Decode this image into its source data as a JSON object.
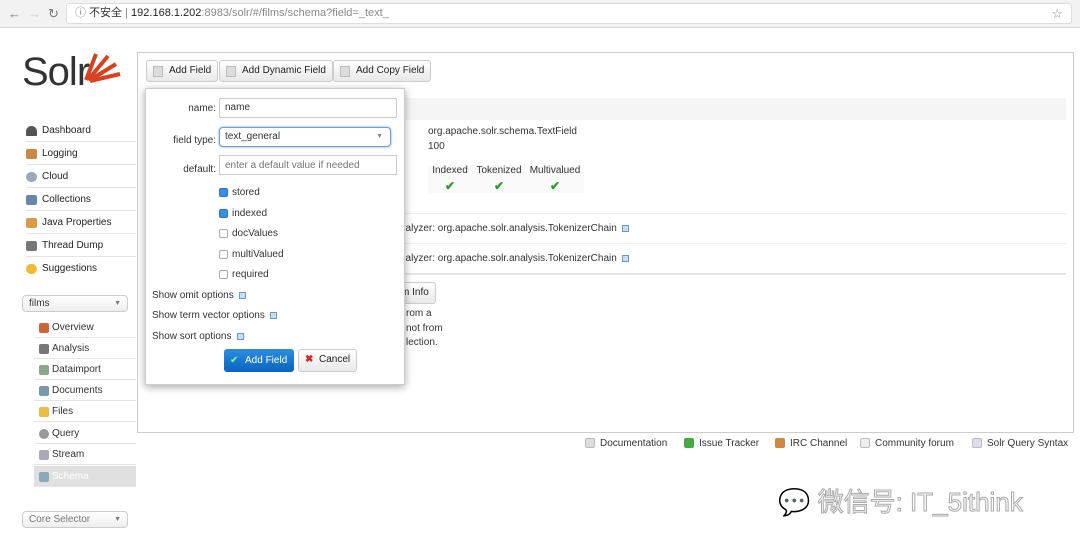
{
  "browser": {
    "insecure_label": "不安全",
    "url_host": "192.168.1.202",
    "url_rest": ":8983/solr/#/films/schema?field=_text_"
  },
  "logo": "Solr",
  "sidebar": {
    "items": [
      {
        "label": "Dashboard",
        "color": "#555"
      },
      {
        "label": "Logging",
        "color": "#c84"
      },
      {
        "label": "Cloud",
        "color": "#9ab"
      },
      {
        "label": "Collections",
        "color": "#68a"
      },
      {
        "label": "Java Properties",
        "color": "#d94"
      },
      {
        "label": "Thread Dump",
        "color": "#777"
      },
      {
        "label": "Suggestions",
        "color": "#eb3"
      }
    ],
    "core_select": "films",
    "core_items": [
      {
        "label": "Overview",
        "color": "#c63"
      },
      {
        "label": "Analysis",
        "color": "#777"
      },
      {
        "label": "Dataimport",
        "color": "#8a8"
      },
      {
        "label": "Documents",
        "color": "#79a"
      },
      {
        "label": "Files",
        "color": "#eb4"
      },
      {
        "label": "Query",
        "color": "#999"
      },
      {
        "label": "Stream",
        "color": "#aab"
      },
      {
        "label": "Schema",
        "color": "#8ab",
        "selected": true
      }
    ],
    "core_selector": "Core Selector"
  },
  "toolbar": {
    "add_field": "Add Field",
    "add_dynamic_field": "Add Dynamic Field",
    "add_copy_field": "Add Copy Field"
  },
  "popup": {
    "name_label": "name:",
    "name_value": "name",
    "field_type_label": "field type:",
    "field_type_value": "text_general",
    "default_label": "default:",
    "default_placeholder": "enter a default value if needed",
    "checkboxes": [
      {
        "label": "stored",
        "checked": true
      },
      {
        "label": "indexed",
        "checked": true
      },
      {
        "label": "docValues",
        "checked": false
      },
      {
        "label": "multiValued",
        "checked": false
      },
      {
        "label": "required",
        "checked": false
      }
    ],
    "show_omit": "Show omit options",
    "show_term_vector": "Show term vector options",
    "show_sort": "Show sort options",
    "submit": "Add Field",
    "cancel": "Cancel"
  },
  "field_info": {
    "class": "org.apache.solr.schema.TextField",
    "position_increment": "100",
    "flags": [
      "Indexed",
      "Tokenized",
      "Multivalued"
    ],
    "index_analyzer": "nalyzer: org.apache.solr.analysis.TokenizerChain",
    "query_analyzer": "nalyzer: org.apache.solr.analysis.TokenizerChain",
    "load_term_info": "m Info",
    "note": [
      "rom a",
      "not from",
      "lection."
    ]
  },
  "footer": [
    "Documentation",
    "Issue Tracker",
    "IRC Channel",
    "Community forum",
    "Solr Query Syntax"
  ],
  "watermark": "微信号: IT_5ithink"
}
